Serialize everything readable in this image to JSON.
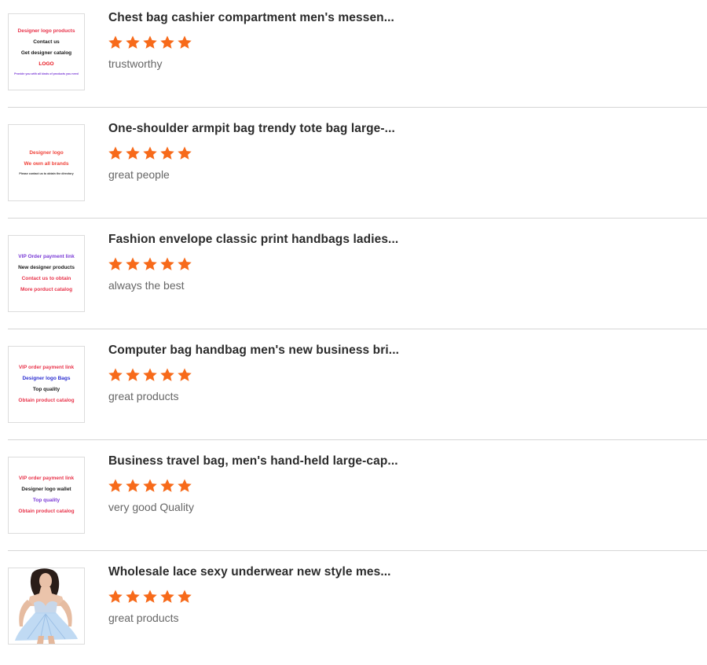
{
  "colors": {
    "star": "#f76a1a",
    "title": "#2b2b2b",
    "comment": "#666666",
    "divider": "#d6d6d6"
  },
  "reviews": [
    {
      "title": "Chest bag cashier compartment men's messen...",
      "rating": 5,
      "comment": "trustworthy",
      "thumb_lines": [
        {
          "text": "Designer logo products",
          "color": "#e8334a",
          "cls": ""
        },
        {
          "text": "Contact us",
          "color": "#1a1a1a",
          "cls": ""
        },
        {
          "text": "Get designer catalog",
          "color": "#1a1a1a",
          "cls": ""
        },
        {
          "text": "LOGO",
          "color": "#e8171f",
          "cls": ""
        },
        {
          "text": "Provide you with all kinds of products you need",
          "color": "#7a3bd6",
          "cls": "tiny"
        }
      ]
    },
    {
      "title": "One-shoulder armpit bag trendy tote bag large-...",
      "rating": 5,
      "comment": "great people",
      "thumb_lines": [
        {
          "text": "Designer logo",
          "color": "#f0433a",
          "cls": ""
        },
        {
          "text": "We own all brands",
          "color": "#f0433a",
          "cls": ""
        },
        {
          "text": "Please contact us to obtain the directory",
          "color": "#333333",
          "cls": "tiny"
        }
      ]
    },
    {
      "title": "Fashion envelope classic print handbags ladies...",
      "rating": 5,
      "comment": "always the best",
      "thumb_lines": [
        {
          "text": "VIP Order payment link",
          "color": "#7a3bd6",
          "cls": ""
        },
        {
          "text": "New designer products",
          "color": "#1a1a1a",
          "cls": ""
        },
        {
          "text": "Contact us to obtain",
          "color": "#e8334a",
          "cls": ""
        },
        {
          "text": "More porduct catalog",
          "color": "#e8334a",
          "cls": ""
        }
      ]
    },
    {
      "title": "Computer bag handbag men's new business bri...",
      "rating": 5,
      "comment": "great products",
      "thumb_lines": [
        {
          "text": "VIP order payment link",
          "color": "#e8334a",
          "cls": ""
        },
        {
          "text": "Designer logo Bags",
          "color": "#2d2fd1",
          "cls": ""
        },
        {
          "text": "Top quality",
          "color": "#1a1a1a",
          "cls": ""
        },
        {
          "text": "Obtain product catalog",
          "color": "#e8334a",
          "cls": ""
        }
      ]
    },
    {
      "title": "Business travel bag, men's hand-held large-cap...",
      "rating": 5,
      "comment": "very good Quality",
      "thumb_lines": [
        {
          "text": "VIP order payment link",
          "color": "#e8334a",
          "cls": ""
        },
        {
          "text": "Designer logo wallet",
          "color": "#1a1a1a",
          "cls": ""
        },
        {
          "text": "Top quality",
          "color": "#7a3bd6",
          "cls": ""
        },
        {
          "text": "Obtain product catalog",
          "color": "#e8334a",
          "cls": ""
        }
      ]
    },
    {
      "title": "Wholesale lace sexy underwear new style mes...",
      "rating": 5,
      "comment": "great products",
      "thumb_lines": []
    }
  ]
}
